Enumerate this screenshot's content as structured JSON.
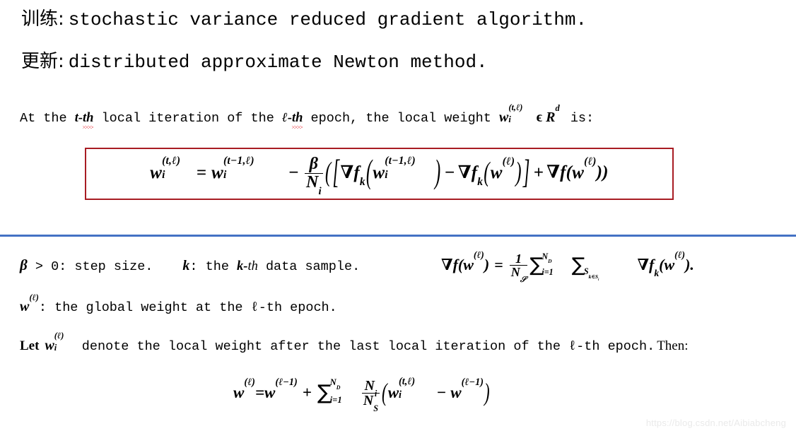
{
  "slide": {
    "title_lines": [
      {
        "label": "训练:",
        "text": "stochastic variance reduced gradient algorithm."
      },
      {
        "label": "更新:",
        "text": "distributed approximate Newton method."
      }
    ],
    "intro": {
      "p1": "At the ",
      "t_term": "t-",
      "t_th": "th",
      "p2": " local iteration of the ",
      "l_term": "ℓ-",
      "l_th": "th",
      "p3": " epoch, the local weight ",
      "w_base": "w",
      "w_sub": "i",
      "w_sup": "(t,ℓ)",
      "p4": "ϵ ",
      "R": "R",
      "R_sup": "d",
      "p5": " is:"
    },
    "equation_box": {
      "border_color": "#a81c23",
      "lhs_base": "w",
      "lhs_sub": "i",
      "lhs_sup": "(t,ℓ)",
      "eq": "=",
      "rhs1_base": "w",
      "rhs1_sub": "i",
      "rhs1_sup": "(t−1,ℓ)",
      "minus": "−",
      "frac_num": "β",
      "frac_den_base": "N",
      "frac_den_sub": "i",
      "open_paren": "(",
      "open_bracket": "[",
      "grad1": "∇f",
      "grad1_sub": "k",
      "arg1_base": "w",
      "arg1_sub": "i",
      "arg1_sup": "(t−1,ℓ)",
      "minus2": "−",
      "grad2": "∇f",
      "grad2_sub": "k",
      "arg2_base": "w",
      "arg2_sup": "(ℓ)",
      "close_bracket": "]",
      "plus": "+",
      "grad3": "∇f",
      "arg3_base": "w",
      "arg3_sup": "(ℓ)",
      "close_parens": "))"
    },
    "divider_color": "#4472c4",
    "definitions": {
      "beta_symbol": "β",
      "beta_rest": " > 0: step size.",
      "k_symbol": "k",
      "k_rest_a": ": the ",
      "k_term": "k-",
      "k_th": "th",
      "k_rest_b": " data sample.",
      "global_base": "w",
      "global_sup": "(ℓ)",
      "global_rest": ": the global weight at the ℓ-th epoch.",
      "let_word": "Let",
      "let_base": "w",
      "let_sub": "i",
      "let_sup": "(ℓ)",
      "let_rest": " denote the local weight after the last local iteration of the ℓ-th epoch.",
      "then_word": "Then:"
    },
    "grad_formula": {
      "grad": "∇f",
      "open": "(",
      "w": "w",
      "w_sup": "(ℓ)",
      "close": ")",
      "eq": "=",
      "frac_num": "1",
      "frac_den_base": "N",
      "frac_den_sub": "𝒮",
      "sum1": "∑",
      "sum1_up": "N",
      "sum1_up_sub": "D",
      "sum1_dn": "i=1",
      "sum2": "∑",
      "sum2_dn": "S",
      "sum2_dn_sub": "k∈S",
      "sum2_dn_sub2": "i",
      "grad_k": "∇f",
      "grad_k_sub": "k",
      "arg_open": "(",
      "arg_w": "w",
      "arg_w_sup": "(ℓ)",
      "arg_close": ").",
      "tail": "."
    },
    "final_equation": {
      "lhs_base": "w",
      "lhs_sup": "(ℓ)",
      "eq": "=",
      "rhs_base": "w",
      "rhs_sup": "(ℓ−1)",
      "plus": "+",
      "sum": "∑",
      "sum_up": "N",
      "sum_up_sub": "D",
      "sum_dn": "i=1",
      "frac_num_base": "N",
      "frac_num_sub": "i",
      "frac_den_base": "N",
      "frac_den_sub": "S",
      "open": "(",
      "term_base": "w",
      "term_sub": "i",
      "term_sup": "(t,ℓ)",
      "minus": "−",
      "last_base": "w",
      "last_sup": "(ℓ−1)",
      "close": ")"
    },
    "watermark": "https://blog.csdn.net/Aibiabcheng"
  }
}
